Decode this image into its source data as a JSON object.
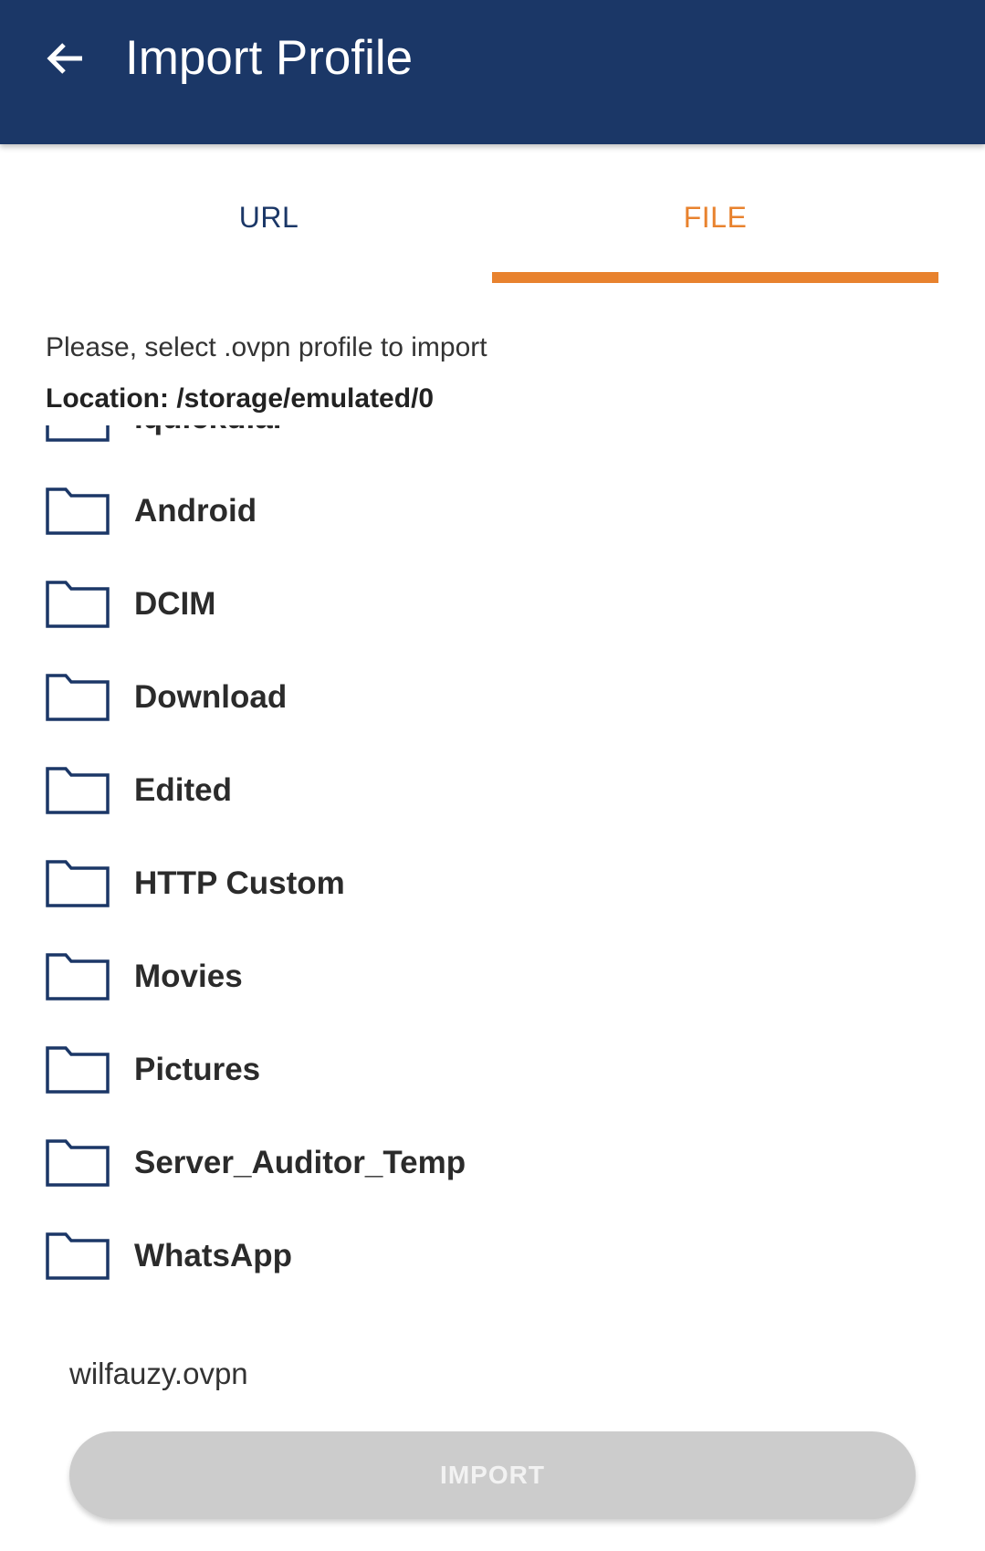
{
  "app_bar": {
    "title": "Import Profile",
    "back_icon": "arrow-left-icon",
    "background": "#1b3767"
  },
  "tabs": [
    {
      "label": "URL",
      "selected": false,
      "color": "#1b3767"
    },
    {
      "label": "FILE",
      "selected": true,
      "color": "#e8822e"
    }
  ],
  "instruction": "Please, select .ovpn profile to import",
  "location": "Location: /storage/emulated/0",
  "folders": [
    {
      "name": ".quickdial",
      "icon": "folder-icon"
    },
    {
      "name": "Android",
      "icon": "folder-icon"
    },
    {
      "name": "DCIM",
      "icon": "folder-icon"
    },
    {
      "name": "Download",
      "icon": "folder-icon"
    },
    {
      "name": "Edited",
      "icon": "folder-icon"
    },
    {
      "name": "HTTP Custom",
      "icon": "folder-icon"
    },
    {
      "name": "Movies",
      "icon": "folder-icon"
    },
    {
      "name": "Pictures",
      "icon": "folder-icon"
    },
    {
      "name": "Server_Auditor_Temp",
      "icon": "folder-icon"
    },
    {
      "name": "WhatsApp",
      "icon": "folder-icon"
    }
  ],
  "selected_file": "wilfauzy.ovpn",
  "import_button": {
    "label": "IMPORT",
    "enabled": false
  },
  "colors": {
    "primary": "#1b3767",
    "accent": "#e8822e",
    "disabled_button": "#cccccc"
  }
}
